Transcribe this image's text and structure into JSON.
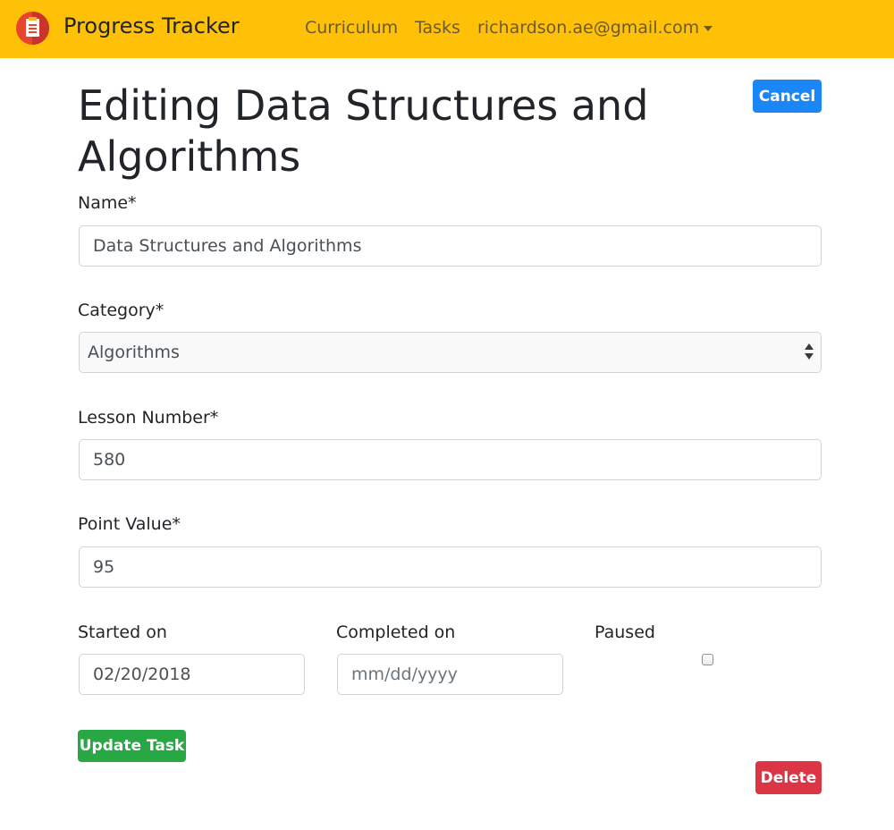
{
  "navbar": {
    "brand": "Progress Tracker",
    "logo_icon": "clipboard-icon",
    "links": [
      "Curriculum",
      "Tasks"
    ],
    "user_email": "richardson.ae@gmail.com",
    "background": "#ffc107"
  },
  "page": {
    "title": "Editing Data Structures and Algorithms",
    "cancel_label": "Cancel"
  },
  "form": {
    "name": {
      "label": "Name*",
      "value": "Data Structures and Algorithms"
    },
    "category": {
      "label": "Category*",
      "selected": "Algorithms"
    },
    "lesson_number": {
      "label": "Lesson Number*",
      "value": "580"
    },
    "point_value": {
      "label": "Point Value*",
      "value": "95"
    },
    "started_on": {
      "label": "Started on",
      "value": "02/20/2018"
    },
    "completed_on": {
      "label": "Completed on",
      "placeholder": "mm/dd/yyyy"
    },
    "paused": {
      "label": "Paused",
      "checked": false
    },
    "update_label": "Update Task",
    "delete_label": "Delete"
  },
  "colors": {
    "primary": "#1b86f5",
    "success": "#28a745",
    "danger": "#dc3545"
  }
}
